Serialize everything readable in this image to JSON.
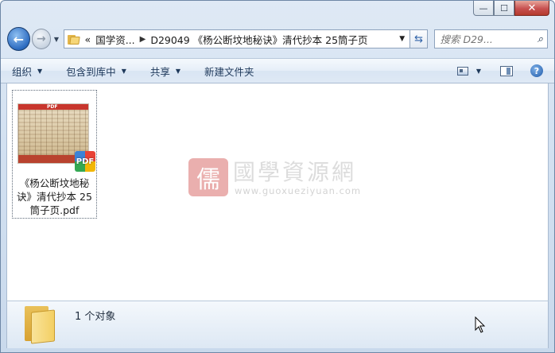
{
  "window": {
    "caption_buttons": {
      "minimize": "—",
      "maximize": "☐",
      "close": "✕"
    }
  },
  "nav": {
    "back_glyph": "←",
    "forward_glyph": "→",
    "breadcrumb_overflow": "«",
    "breadcrumb": [
      "国学资...",
      "D29049 《杨公断坟地秘诀》清代抄本 25筒子页"
    ],
    "search_placeholder": "搜索 D29..."
  },
  "toolbar": {
    "organize": "组织",
    "include_in_library": "包含到库中",
    "share": "共享",
    "new_folder": "新建文件夹",
    "help": "?"
  },
  "content": {
    "files": [
      {
        "name": "《杨公断坟地秘诀》清代抄本 25筒子页.pdf",
        "thumb_tag": "PDF",
        "badge": "PDF"
      }
    ],
    "watermark": {
      "logo_char": "儒",
      "title": "國學資源網",
      "url": "www.guoxueziyuan.com"
    }
  },
  "status": {
    "count_text": "1 个对象"
  },
  "colors": {
    "accent": "#2c6bc0",
    "close_red": "#c75050",
    "toolbar_text": "#1e395b"
  }
}
